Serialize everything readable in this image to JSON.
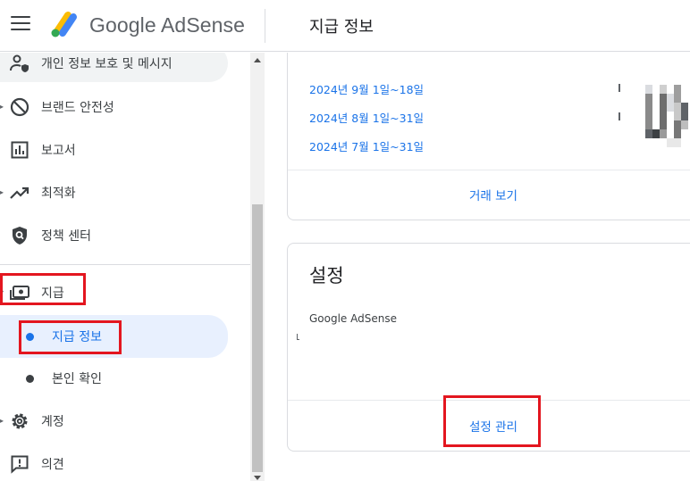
{
  "header": {
    "brand": "Google AdSense",
    "page_title": "지급 정보"
  },
  "sidebar": {
    "items": [
      {
        "label": "개인 정보 보호 및 메시지",
        "icon": "person-shield-icon"
      },
      {
        "label": "브랜드 안전성",
        "icon": "block-icon"
      },
      {
        "label": "보고서",
        "icon": "bar-chart-icon"
      },
      {
        "label": "최적화",
        "icon": "trending-up-icon"
      },
      {
        "label": "정책 센터",
        "icon": "policy-shield-icon"
      },
      {
        "label": "지급",
        "icon": "payments-icon"
      },
      {
        "label": "지급 정보",
        "icon": "dot"
      },
      {
        "label": "본인 확인",
        "icon": "dot"
      },
      {
        "label": "계정",
        "icon": "gear-icon"
      },
      {
        "label": "의견",
        "icon": "feedback-icon"
      }
    ]
  },
  "transactions": {
    "periods": [
      "2024년 9월 1일~18일",
      "2024년 8월 1일~31일",
      "2024년 7월 1일~31일"
    ],
    "view_transactions": "거래 보기"
  },
  "settings": {
    "title": "설정",
    "account_name": "Google AdSense",
    "manage": "설정 관리"
  },
  "colors": {
    "accent": "#1a73e8",
    "highlight": "#e3161f",
    "active_bg": "#e8f0fe"
  }
}
